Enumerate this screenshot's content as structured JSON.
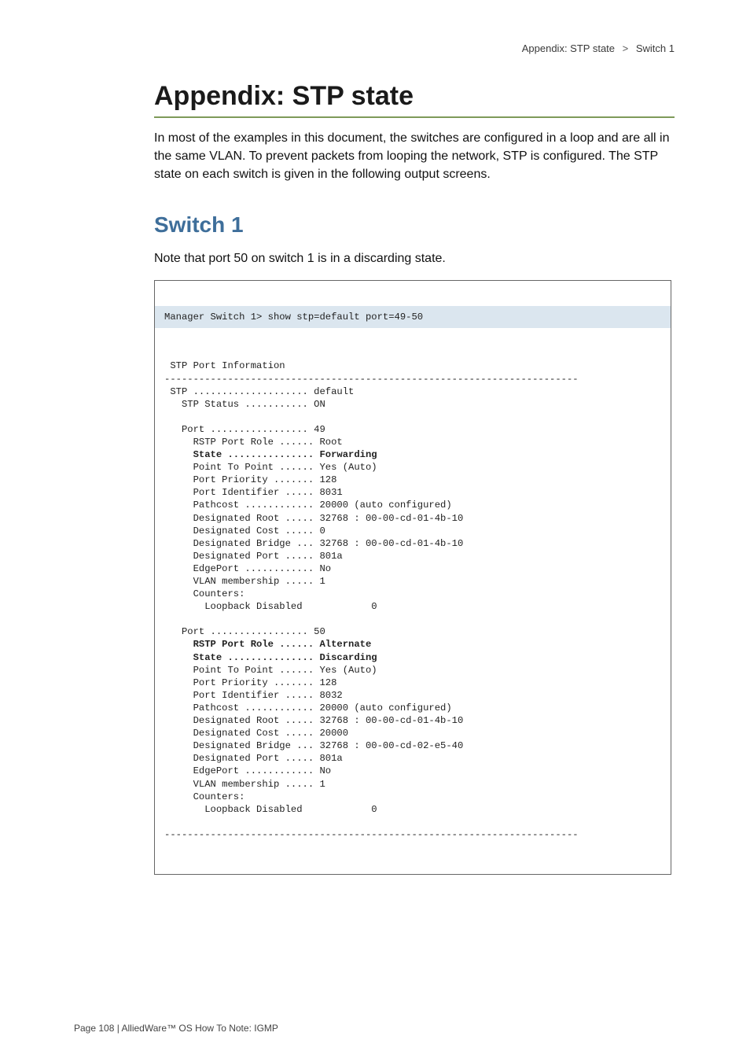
{
  "header": {
    "breadcrumb_left": "Appendix: STP state",
    "breadcrumb_arrow": ">",
    "breadcrumb_right": "Switch 1"
  },
  "appendix": {
    "title": "Appendix: STP state",
    "intro": "In most of the examples in this document, the switches are configured in a loop and are all in the same VLAN. To prevent packets from looping the network, STP is configured. The STP state on each switch is given in the following output screens."
  },
  "section": {
    "title": "Switch 1",
    "note": "Note that port 50 on switch 1 is in a discarding state."
  },
  "cli": {
    "command": "Manager Switch 1> show stp=default port=49-50",
    "out_pre1": " STP Port Information\n------------------------------------------------------------------------\n STP .................... default\n   STP Status ........... ON\n\n   Port ................. 49\n     RSTP Port Role ...... Root\n     ",
    "out_bold1": "State ............... Forwarding",
    "out_pre2": "\n     Point To Point ...... Yes (Auto)\n     Port Priority ....... 128\n     Port Identifier ..... 8031\n     Pathcost ............ 20000 (auto configured)\n     Designated Root ..... 32768 : 00-00-cd-01-4b-10\n     Designated Cost ..... 0\n     Designated Bridge ... 32768 : 00-00-cd-01-4b-10\n     Designated Port ..... 801a\n     EdgePort ............ No\n     VLAN membership ..... 1\n     Counters:\n       Loopback Disabled            0\n\n   Port ................. 50\n     ",
    "out_bold2": "RSTP Port Role ...... Alternate",
    "out_pre3": "\n     ",
    "out_bold3": "State ............... Discarding",
    "out_pre4": "\n     Point To Point ...... Yes (Auto)\n     Port Priority ....... 128\n     Port Identifier ..... 8032\n     Pathcost ............ 20000 (auto configured)\n     Designated Root ..... 32768 : 00-00-cd-01-4b-10\n     Designated Cost ..... 20000\n     Designated Bridge ... 32768 : 00-00-cd-02-e5-40\n     Designated Port ..... 801a\n     EdgePort ............ No\n     VLAN membership ..... 1\n     Counters:\n       Loopback Disabled            0\n\n------------------------------------------------------------------------"
  },
  "footer": {
    "text": "Page 108 | AlliedWare™ OS How To Note: IGMP"
  }
}
